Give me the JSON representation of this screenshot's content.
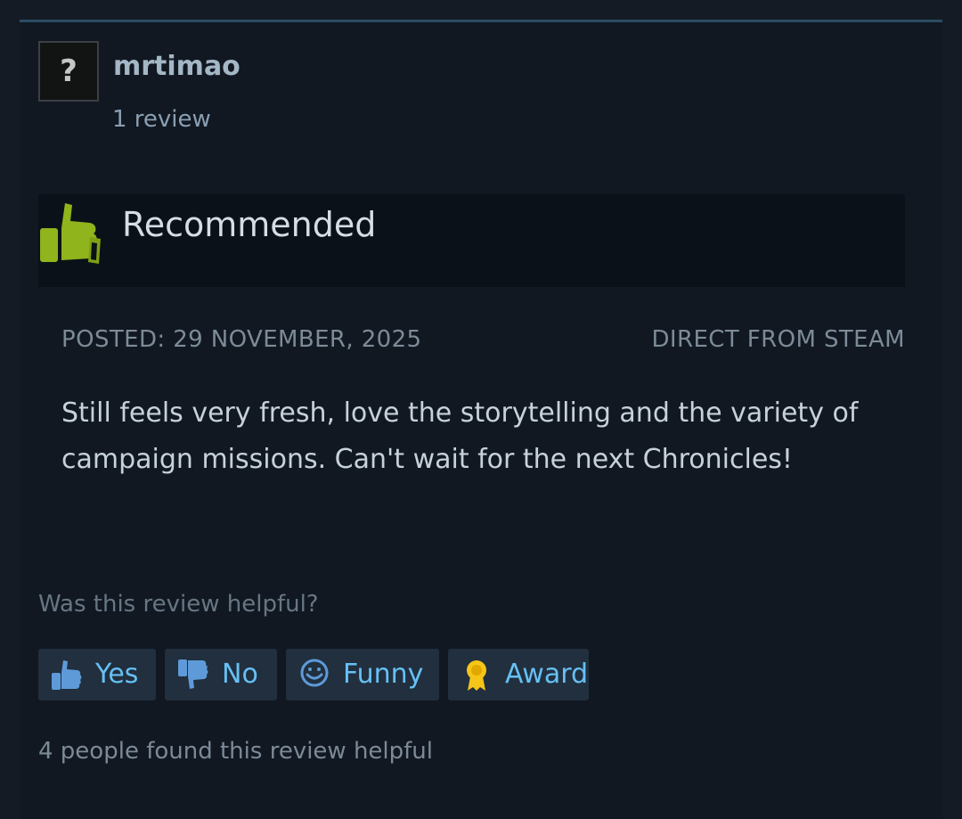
{
  "author": {
    "name": "mrtimao",
    "review_count": "1 review",
    "avatar_placeholder": "?"
  },
  "recommendation": {
    "label": "Recommended",
    "icon": "thumbs-up-icon",
    "icon_color": "#a4d007"
  },
  "meta": {
    "posted": "POSTED: 29 NOVEMBER, 2025",
    "source": "DIRECT FROM STEAM"
  },
  "review": {
    "text": "Still feels very fresh, love the storytelling and the variety of campaign missions. Can't wait for the next Chronicles!"
  },
  "helpfulness": {
    "question": "Was this review helpful?",
    "buttons": [
      {
        "label": "Yes",
        "icon": "thumbs-up-icon"
      },
      {
        "label": "No",
        "icon": "thumbs-down-icon"
      },
      {
        "label": "Funny",
        "icon": "smiley-icon"
      },
      {
        "label": "Award",
        "icon": "award-icon"
      }
    ],
    "summary": "4 people found this review helpful"
  },
  "colors": {
    "page_bg": "#141b24",
    "card_bg": "#111822",
    "accent_link": "#66c0f4",
    "award_gold": "#f5c518"
  }
}
